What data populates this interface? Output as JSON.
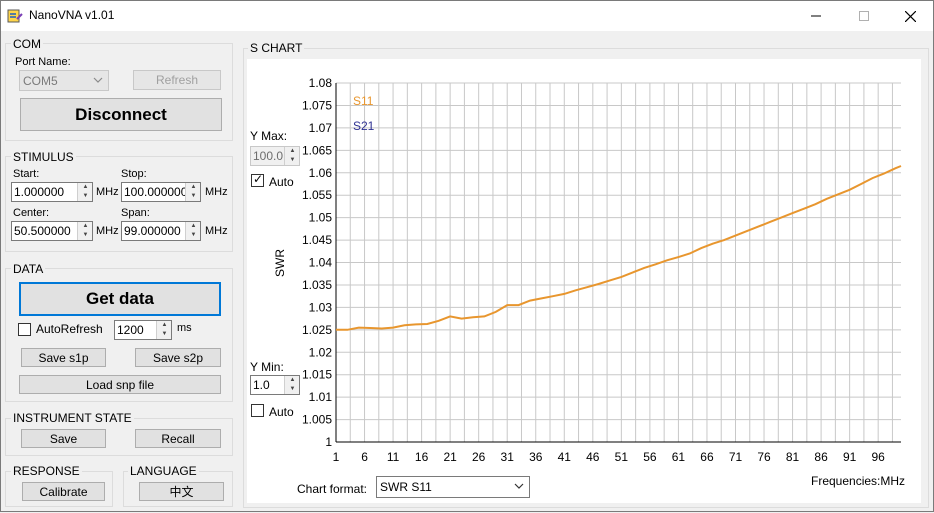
{
  "window": {
    "title": "NanoVNA v1.01"
  },
  "com": {
    "group_label": "COM",
    "port_name_label": "Port Name:",
    "port_value": "COM5",
    "refresh_label": "Refresh",
    "disconnect_label": "Disconnect"
  },
  "stimulus": {
    "group_label": "STIMULUS",
    "start_label": "Start:",
    "start_value": "1.000000",
    "start_unit": "MHz",
    "stop_label": "Stop:",
    "stop_value": "100.000000",
    "stop_unit": "MHz",
    "center_label": "Center:",
    "center_value": "50.500000",
    "center_unit": "MHz",
    "span_label": "Span:",
    "span_value": "99.000000",
    "span_unit": "MHz"
  },
  "data": {
    "group_label": "DATA",
    "get_data_label": "Get data",
    "autorefresh_label": "AutoRefresh",
    "autorefresh_checked": false,
    "interval_value": "1200",
    "interval_unit": "ms",
    "save_s1p_label": "Save s1p",
    "save_s2p_label": "Save s2p",
    "load_snp_label": "Load snp file"
  },
  "instrument_state": {
    "group_label": "INSTRUMENT STATE",
    "save_label": "Save",
    "recall_label": "Recall"
  },
  "response": {
    "group_label": "RESPONSE",
    "calibrate_label": "Calibrate"
  },
  "language": {
    "group_label": "LANGUAGE",
    "button_label": "中文"
  },
  "s_chart": {
    "group_label": "S CHART",
    "ymax_label": "Y Max:",
    "ymax_value": "100.0",
    "ymax_auto_label": "Auto",
    "ymax_auto_checked": true,
    "ymin_label": "Y Min:",
    "ymin_value": "1.0",
    "ymin_auto_label": "Auto",
    "ymin_auto_checked": false,
    "chart_format_label": "Chart format:",
    "chart_format_value": "SWR S11",
    "frequencies_label": "Frequencies:MHz"
  },
  "colors": {
    "s11": "#e8962e",
    "s21": "#2e3192",
    "focus": "#0078d7"
  },
  "chart_data": {
    "type": "line",
    "ylabel": "SWR",
    "xlabel": "Frequencies:MHz",
    "xlim": [
      1,
      100
    ],
    "ylim": [
      1,
      1.08
    ],
    "x_ticks": [
      1,
      6,
      11,
      16,
      21,
      26,
      31,
      36,
      41,
      46,
      51,
      56,
      61,
      66,
      71,
      76,
      81,
      86,
      91,
      96
    ],
    "y_ticks": [
      "1",
      "1.005",
      "1.01",
      "1.015",
      "1.02",
      "1.025",
      "1.03",
      "1.035",
      "1.04",
      "1.045",
      "1.05",
      "1.055",
      "1.06",
      "1.065",
      "1.07",
      "1.075",
      "1.08"
    ],
    "grid": true,
    "legend": [
      "S11",
      "S21"
    ],
    "series": [
      {
        "name": "S11",
        "x": [
          1,
          3,
          5,
          7,
          9,
          11,
          13,
          15,
          17,
          19,
          21,
          23,
          25,
          27,
          29,
          31,
          33,
          35,
          37,
          39,
          41,
          43,
          45,
          47,
          49,
          51,
          53,
          55,
          57,
          59,
          61,
          63,
          65,
          67,
          69,
          71,
          73,
          75,
          77,
          79,
          81,
          83,
          85,
          87,
          89,
          91,
          93,
          95,
          97,
          99,
          100
        ],
        "y": [
          1.025,
          1.025,
          1.0255,
          1.0254,
          1.0253,
          1.0255,
          1.026,
          1.0262,
          1.0263,
          1.027,
          1.028,
          1.0275,
          1.0278,
          1.028,
          1.029,
          1.0305,
          1.0305,
          1.0315,
          1.032,
          1.0325,
          1.033,
          1.0338,
          1.0345,
          1.0352,
          1.036,
          1.0368,
          1.0378,
          1.0388,
          1.0396,
          1.0405,
          1.0412,
          1.042,
          1.0432,
          1.0442,
          1.045,
          1.046,
          1.047,
          1.048,
          1.049,
          1.05,
          1.051,
          1.052,
          1.053,
          1.0542,
          1.0552,
          1.0562,
          1.0575,
          1.0588,
          1.0598,
          1.061,
          1.0615
        ]
      }
    ]
  }
}
